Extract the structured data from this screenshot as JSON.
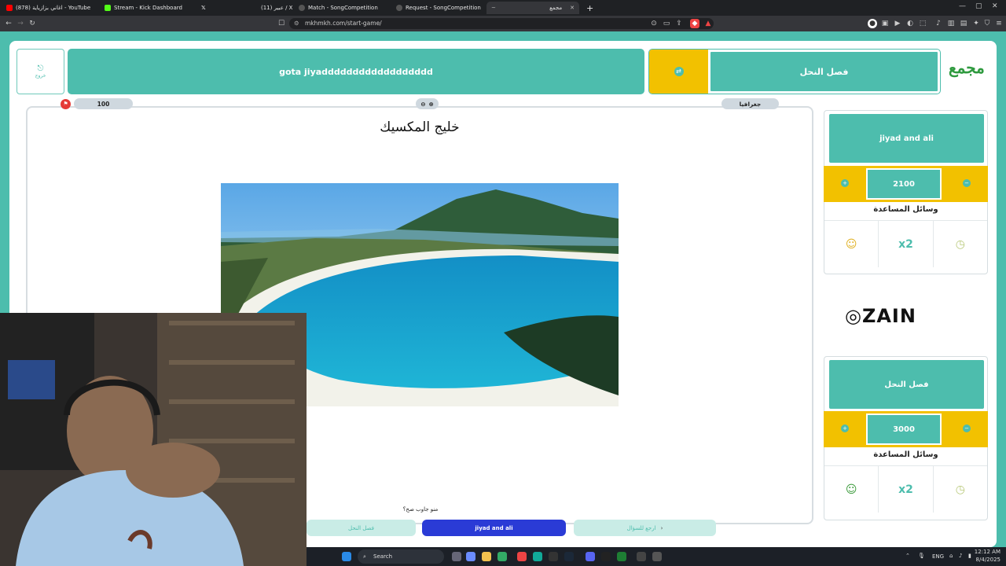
{
  "browser": {
    "tabs": [
      {
        "title": "(878) اغاني بزازياية - YouTube",
        "color": "#ff0000"
      },
      {
        "title": "Stream - Kick Dashboard",
        "color": "#53fc18"
      },
      {
        "title": "",
        "color": "#ffffff"
      },
      {
        "title": "(11) عبير / X",
        "color": "#cccccc"
      },
      {
        "title": "Match - SongCompetition",
        "color": "#cccccc"
      },
      {
        "title": "Request - SongCompetition",
        "color": "#cccccc"
      },
      {
        "title": "مجمع",
        "color": "#4dbdad"
      }
    ],
    "new_tab": "+",
    "url": "mkhmkh.com/start-game/"
  },
  "header": {
    "exit_label": "خروج",
    "game_title": "gota jiyadddddddddddddddddd",
    "active_team": "فصل النحل",
    "logo_text": "مجمع"
  },
  "question": {
    "points": "100",
    "category": "جغرافيا",
    "title": "خليج المكسيك",
    "prompt": "منو جاوب صح؟"
  },
  "answer_buttons": {
    "team2": "فصل النحل",
    "team1": "jiyad and ali",
    "back": "ارجع للسؤال"
  },
  "teams": [
    {
      "name": "jiyad and ali",
      "score": "2100",
      "help_title": "وسائل المساعدة",
      "help_tools": [
        "person-icon",
        "x2-icon",
        "timer-icon"
      ]
    },
    {
      "name": "فصل النحل",
      "score": "3000",
      "help_title": "وسائل المساعدة",
      "help_tools": [
        "person-icon",
        "x2-icon",
        "timer-icon"
      ]
    }
  ],
  "help_x2": "x2",
  "sponsor": "ZAIN",
  "taskbar": {
    "search": "Search",
    "lang": "ENG",
    "time": "12:12 AM",
    "date": "8/4/2025"
  },
  "colors": {
    "teal": "#4dbdad",
    "yellow": "#f2c100",
    "blue": "#2a3bd6"
  }
}
